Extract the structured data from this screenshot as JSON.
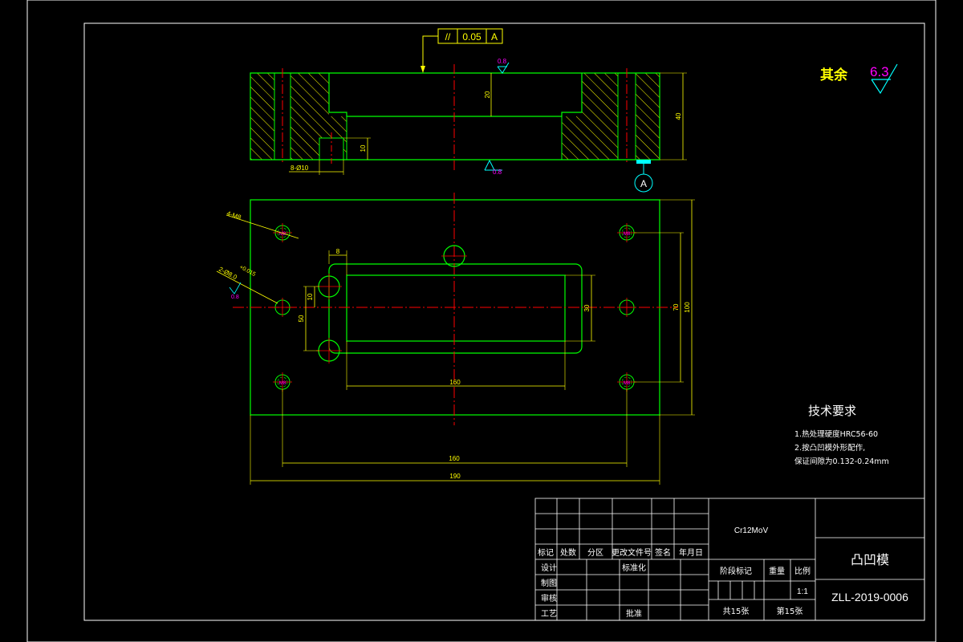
{
  "colors": {
    "background": "#000000",
    "frame": "#ffffff",
    "outline": "#00ff00",
    "hatch": "#ffff00",
    "dimension": "#ffff00",
    "centerline": "#ff0000",
    "surface_symbol": "#00ffff",
    "symbol_value": "#ff00ff",
    "tolerance": "#ffff00"
  },
  "tolerance_frame": {
    "symbol": "//",
    "value": "0.05",
    "datum": "A"
  },
  "datum_label": "A",
  "section_view": {
    "roughness_top": "0.8",
    "roughness_bottom": "0.8",
    "dim_depth": "20",
    "dim_height": "40",
    "dim_pin_depth": "10",
    "pin_hole_label": "8-Ø10"
  },
  "plan_view": {
    "screw_holes_label": "4-M8",
    "pin_holes_label": "2-Ø8.0",
    "pin_holes_tol": "+0.015",
    "pin_holes_roughness": "0.8",
    "hole_tag_top_left": "M8",
    "hole_tag_top_right": "M8",
    "hole_tag_bottom_left": "M8",
    "hole_tag_bottom_right": "M8",
    "dim_wall": "8",
    "dim_10": "10",
    "dim_50": "50",
    "dim_30": "30",
    "dim_70": "70",
    "dim_100": "100",
    "dim_slot_len": "160",
    "dim_hole_span": "160",
    "dim_total_len": "190"
  },
  "roughness_note": {
    "label": "其余",
    "value": "6.3"
  },
  "tech_requirements": {
    "title": "技术要求",
    "line1": "1.热处理硬度HRC56-60",
    "line2": "2.按凸凹模外形配作,",
    "line3": "保证间隙为0.132-0.24mm"
  },
  "title_block": {
    "material": "Cr12MoV",
    "part_name": "凸凹模",
    "drawing_no": "ZLL-2019-0006",
    "h_mark": "标记",
    "h_count": "处数",
    "h_zone": "分区",
    "h_docno": "更改文件号",
    "h_sign": "签名",
    "h_date": "年月日",
    "design": "设计",
    "standardize": "标准化",
    "draw": "制图",
    "review": "审核",
    "process": "工艺",
    "approve": "批准",
    "stage_mark": "阶段标记",
    "weight": "重量",
    "scale": "比例",
    "scale_value": "1:1",
    "sheets_total": "共15张",
    "sheet_no": "第15张"
  }
}
